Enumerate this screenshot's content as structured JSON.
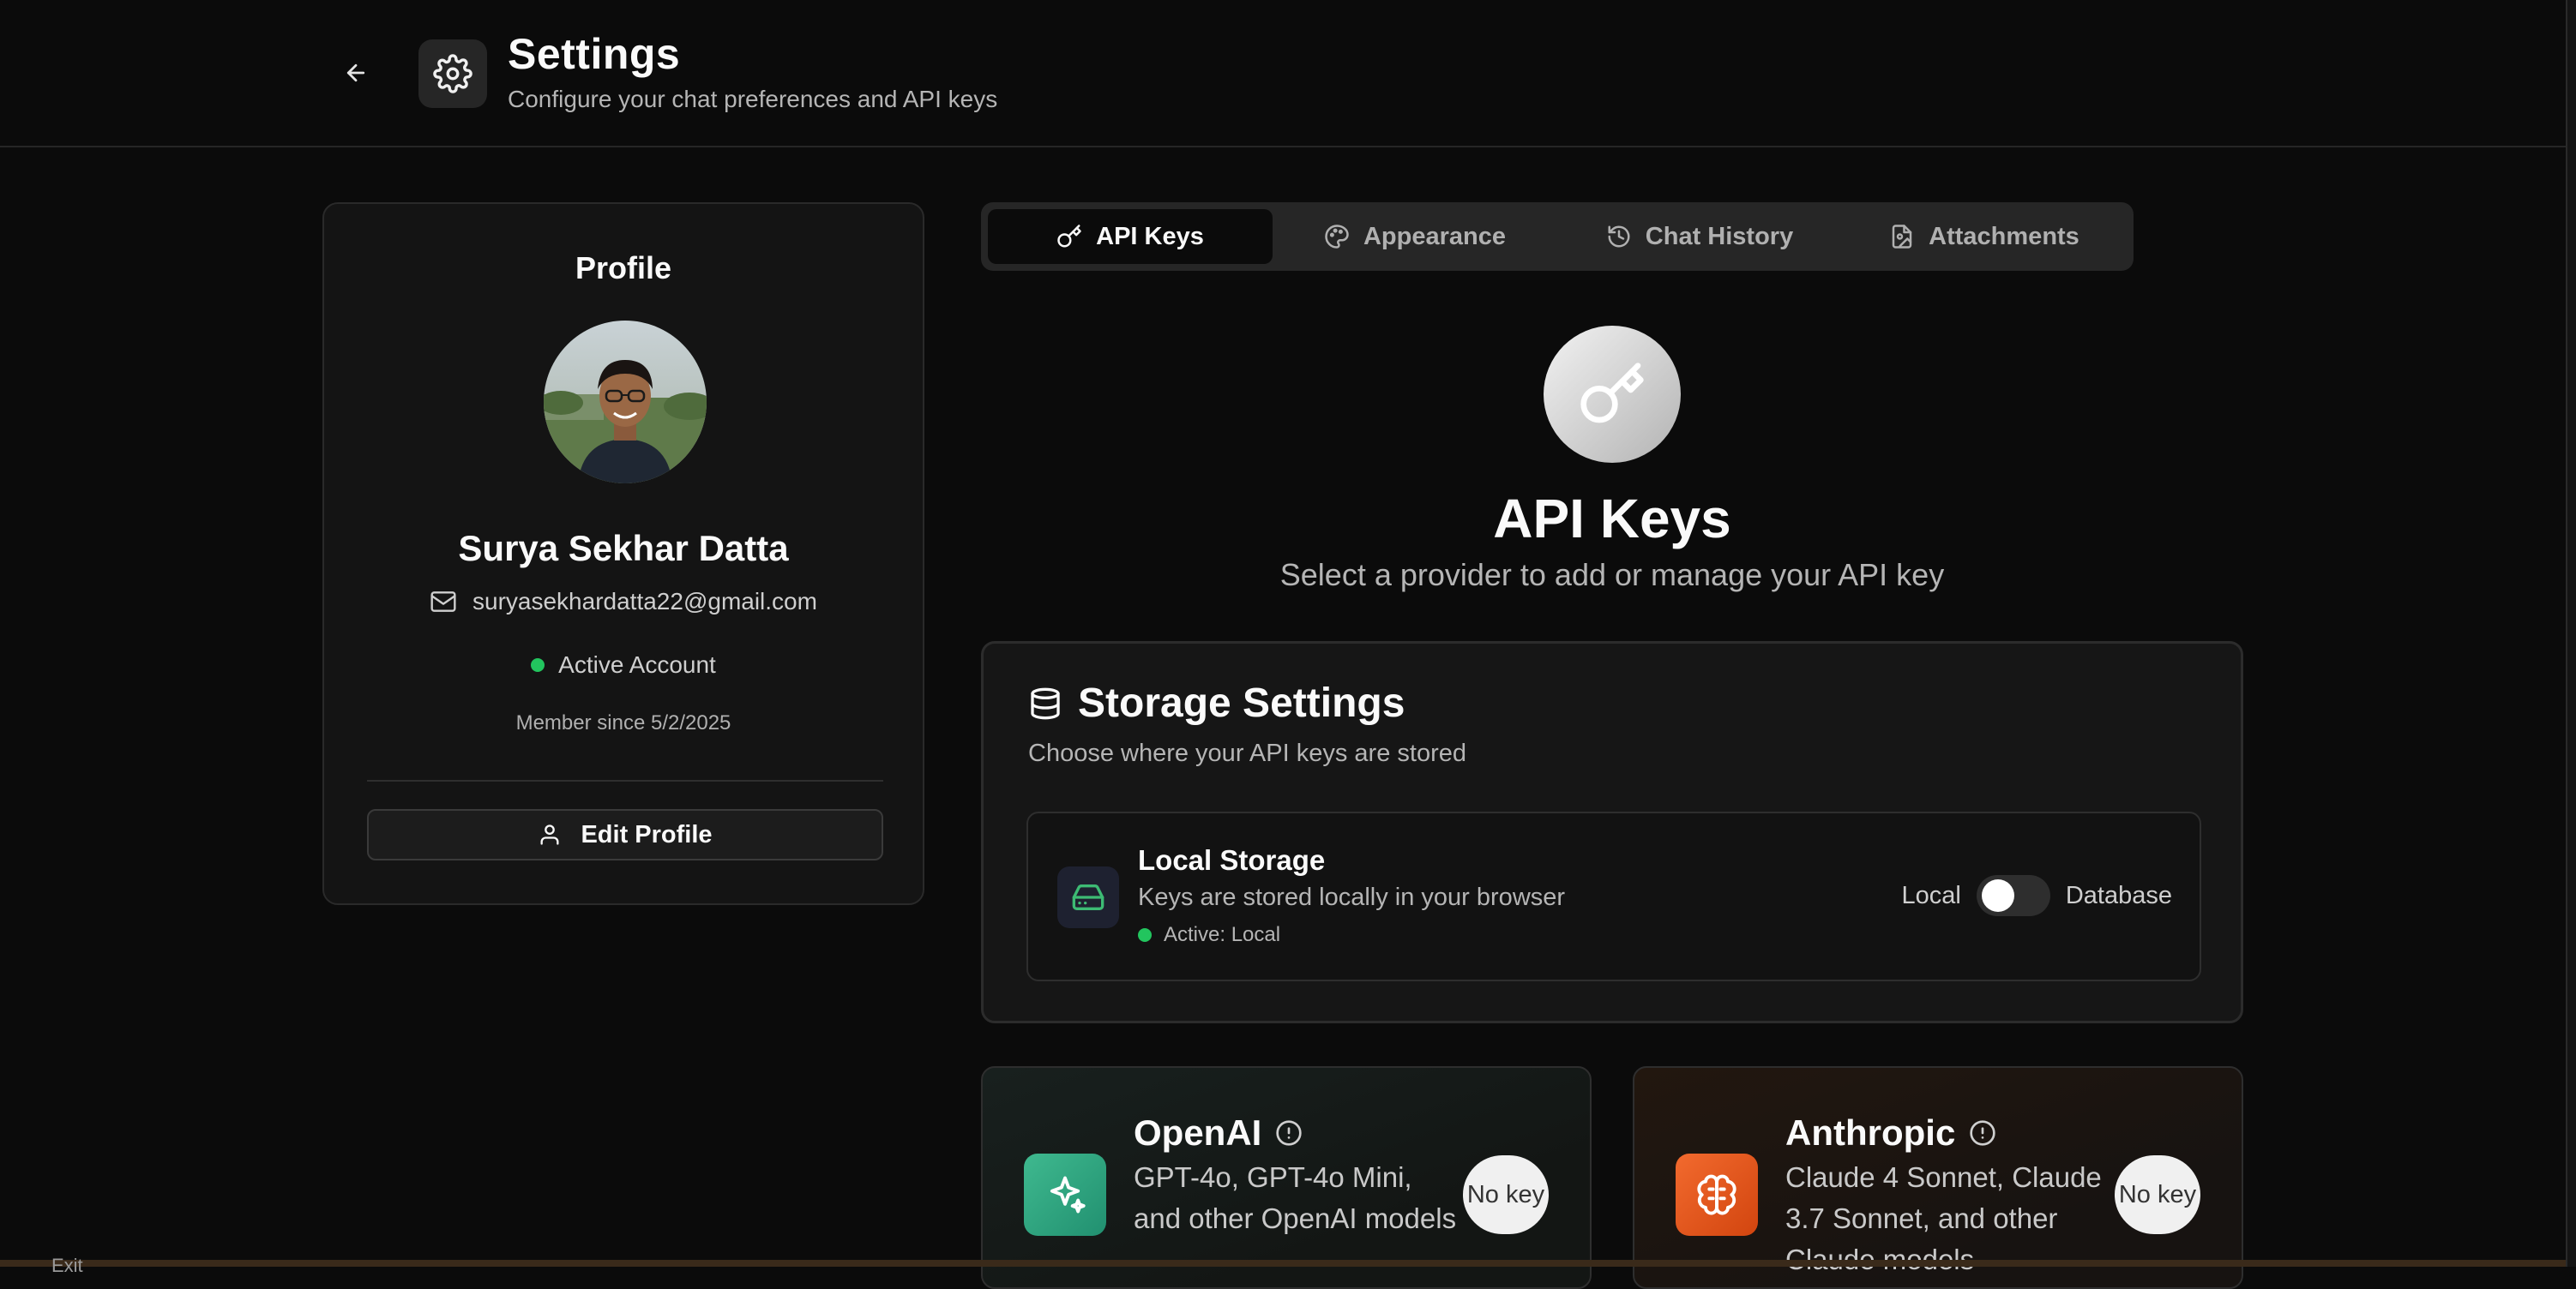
{
  "header": {
    "title": "Settings",
    "subtitle": "Configure your chat preferences and API keys",
    "icons": {
      "back": "arrow-left-icon",
      "settings": "gear-icon"
    }
  },
  "profile": {
    "heading": "Profile",
    "name": "Surya Sekhar Datta",
    "email": "suryasekhardatta22@gmail.com",
    "status": "Active Account",
    "member_since": "Member since 5/2/2025",
    "edit_button": "Edit Profile",
    "status_color": "#22c55e"
  },
  "tabs": [
    {
      "label": "API Keys",
      "icon": "key-icon",
      "active": true
    },
    {
      "label": "Appearance",
      "icon": "palette-icon",
      "active": false
    },
    {
      "label": "Chat History",
      "icon": "history-icon",
      "active": false
    },
    {
      "label": "Attachments",
      "icon": "file-image-icon",
      "active": false
    }
  ],
  "api_keys": {
    "title": "API Keys",
    "subtitle": "Select a provider to add or manage your API key"
  },
  "storage": {
    "title": "Storage Settings",
    "description": "Choose where your API keys are stored",
    "local_title": "Local Storage",
    "local_description": "Keys are stored locally in your browser",
    "active_label": "Active: Local",
    "toggle_left": "Local",
    "toggle_right": "Database",
    "toggle_on": false
  },
  "providers": [
    {
      "name": "OpenAI",
      "description": "GPT-4o, GPT-4o Mini, and other OpenAI models",
      "badge": "No key",
      "accent": "#2fa880"
    },
    {
      "name": "Anthropic",
      "description": "Claude 4 Sonnet, Claude 3.7 Sonnet, and other Claude models",
      "badge": "No key",
      "accent": "#e8581c"
    }
  ],
  "bottom_fragment": "Exit"
}
